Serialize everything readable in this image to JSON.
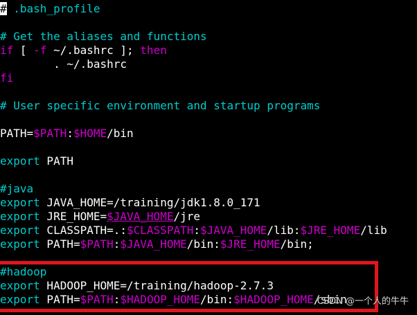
{
  "editor": {
    "lines": [
      {
        "row": 0,
        "segments": [
          {
            "t": "#",
            "cls": "cursor"
          },
          {
            "t": " .bash_profile",
            "cls": "c-comment"
          }
        ]
      },
      {
        "row": 1,
        "segments": []
      },
      {
        "row": 2,
        "segments": [
          {
            "t": "# Get the aliases and functions",
            "cls": "c-comment"
          }
        ]
      },
      {
        "row": 3,
        "segments": [
          {
            "t": "if",
            "cls": "c-keyword"
          },
          {
            "t": " [ ",
            "cls": "c-path"
          },
          {
            "t": "-f",
            "cls": "c-keyword"
          },
          {
            "t": " ~/.bashrc ]; ",
            "cls": "c-path"
          },
          {
            "t": "then",
            "cls": "c-keyword"
          }
        ]
      },
      {
        "row": 4,
        "segments": [
          {
            "t": "        . ~/.bashrc",
            "cls": "c-path"
          }
        ]
      },
      {
        "row": 5,
        "segments": [
          {
            "t": "fi",
            "cls": "c-keyword"
          }
        ]
      },
      {
        "row": 6,
        "segments": []
      },
      {
        "row": 7,
        "segments": [
          {
            "t": "# User specific environment and startup programs",
            "cls": "c-comment"
          }
        ]
      },
      {
        "row": 8,
        "segments": []
      },
      {
        "row": 9,
        "segments": [
          {
            "t": "PATH=",
            "cls": "c-path"
          },
          {
            "t": "$PATH",
            "cls": "c-var"
          },
          {
            "t": ":",
            "cls": "c-path"
          },
          {
            "t": "$HOME",
            "cls": "c-var"
          },
          {
            "t": "/bin",
            "cls": "c-path"
          }
        ]
      },
      {
        "row": 10,
        "segments": []
      },
      {
        "row": 11,
        "segments": [
          {
            "t": "export",
            "cls": "c-export"
          },
          {
            "t": " PATH",
            "cls": "c-path"
          }
        ]
      },
      {
        "row": 12,
        "segments": []
      },
      {
        "row": 13,
        "segments": [
          {
            "t": "#java",
            "cls": "c-comment"
          }
        ]
      },
      {
        "row": 14,
        "segments": [
          {
            "t": "export",
            "cls": "c-export"
          },
          {
            "t": " JAVA_HOME=/training/jdk1.8.0_171",
            "cls": "c-path"
          }
        ]
      },
      {
        "row": 15,
        "segments": [
          {
            "t": "export",
            "cls": "c-export"
          },
          {
            "t": " JRE_HOME=",
            "cls": "c-path"
          },
          {
            "t": "$JAVA_HOME",
            "cls": "c-var c-ul"
          },
          {
            "t": "/jre",
            "cls": "c-path"
          }
        ]
      },
      {
        "row": 16,
        "segments": [
          {
            "t": "export",
            "cls": "c-export"
          },
          {
            "t": " CLASSPATH=.:",
            "cls": "c-path"
          },
          {
            "t": "$CLASSPATH",
            "cls": "c-var"
          },
          {
            "t": ":",
            "cls": "c-path"
          },
          {
            "t": "$JAVA_HOME",
            "cls": "c-var"
          },
          {
            "t": "/lib:",
            "cls": "c-path"
          },
          {
            "t": "$JRE_HOME",
            "cls": "c-var"
          },
          {
            "t": "/lib",
            "cls": "c-path"
          }
        ]
      },
      {
        "row": 17,
        "segments": [
          {
            "t": "export",
            "cls": "c-export"
          },
          {
            "t": " PATH=",
            "cls": "c-path"
          },
          {
            "t": "$PATH",
            "cls": "c-var"
          },
          {
            "t": ":",
            "cls": "c-path"
          },
          {
            "t": "$JAVA_HOME",
            "cls": "c-var"
          },
          {
            "t": "/bin:",
            "cls": "c-path"
          },
          {
            "t": "$JRE_HOME",
            "cls": "c-var"
          },
          {
            "t": "/bin;",
            "cls": "c-path"
          }
        ]
      },
      {
        "row": 18,
        "segments": []
      },
      {
        "row": 19,
        "segments": [
          {
            "t": "#hadoop",
            "cls": "c-comment"
          }
        ]
      },
      {
        "row": 20,
        "segments": [
          {
            "t": "export",
            "cls": "c-export"
          },
          {
            "t": " HADOOP_HOME=/training/hadoop-2.7.3",
            "cls": "c-path"
          }
        ]
      },
      {
        "row": 21,
        "segments": [
          {
            "t": "export",
            "cls": "c-export"
          },
          {
            "t": " PATH=",
            "cls": "c-path"
          },
          {
            "t": "$PATH",
            "cls": "c-var"
          },
          {
            "t": ":",
            "cls": "c-path"
          },
          {
            "t": "$HADOOP_HOME",
            "cls": "c-var"
          },
          {
            "t": "/bin:",
            "cls": "c-path"
          },
          {
            "t": "$HADOOP_HOME",
            "cls": "c-var"
          },
          {
            "t": "/sbin",
            "cls": "c-path"
          }
        ]
      }
    ]
  },
  "watermark": "CSDN @一个人的牛牛",
  "colors": {
    "background": "#000000",
    "comment": "#00cdcd",
    "keyword": "#cd00cd",
    "text": "#ffffff",
    "highlight_box": "#e0161c"
  }
}
